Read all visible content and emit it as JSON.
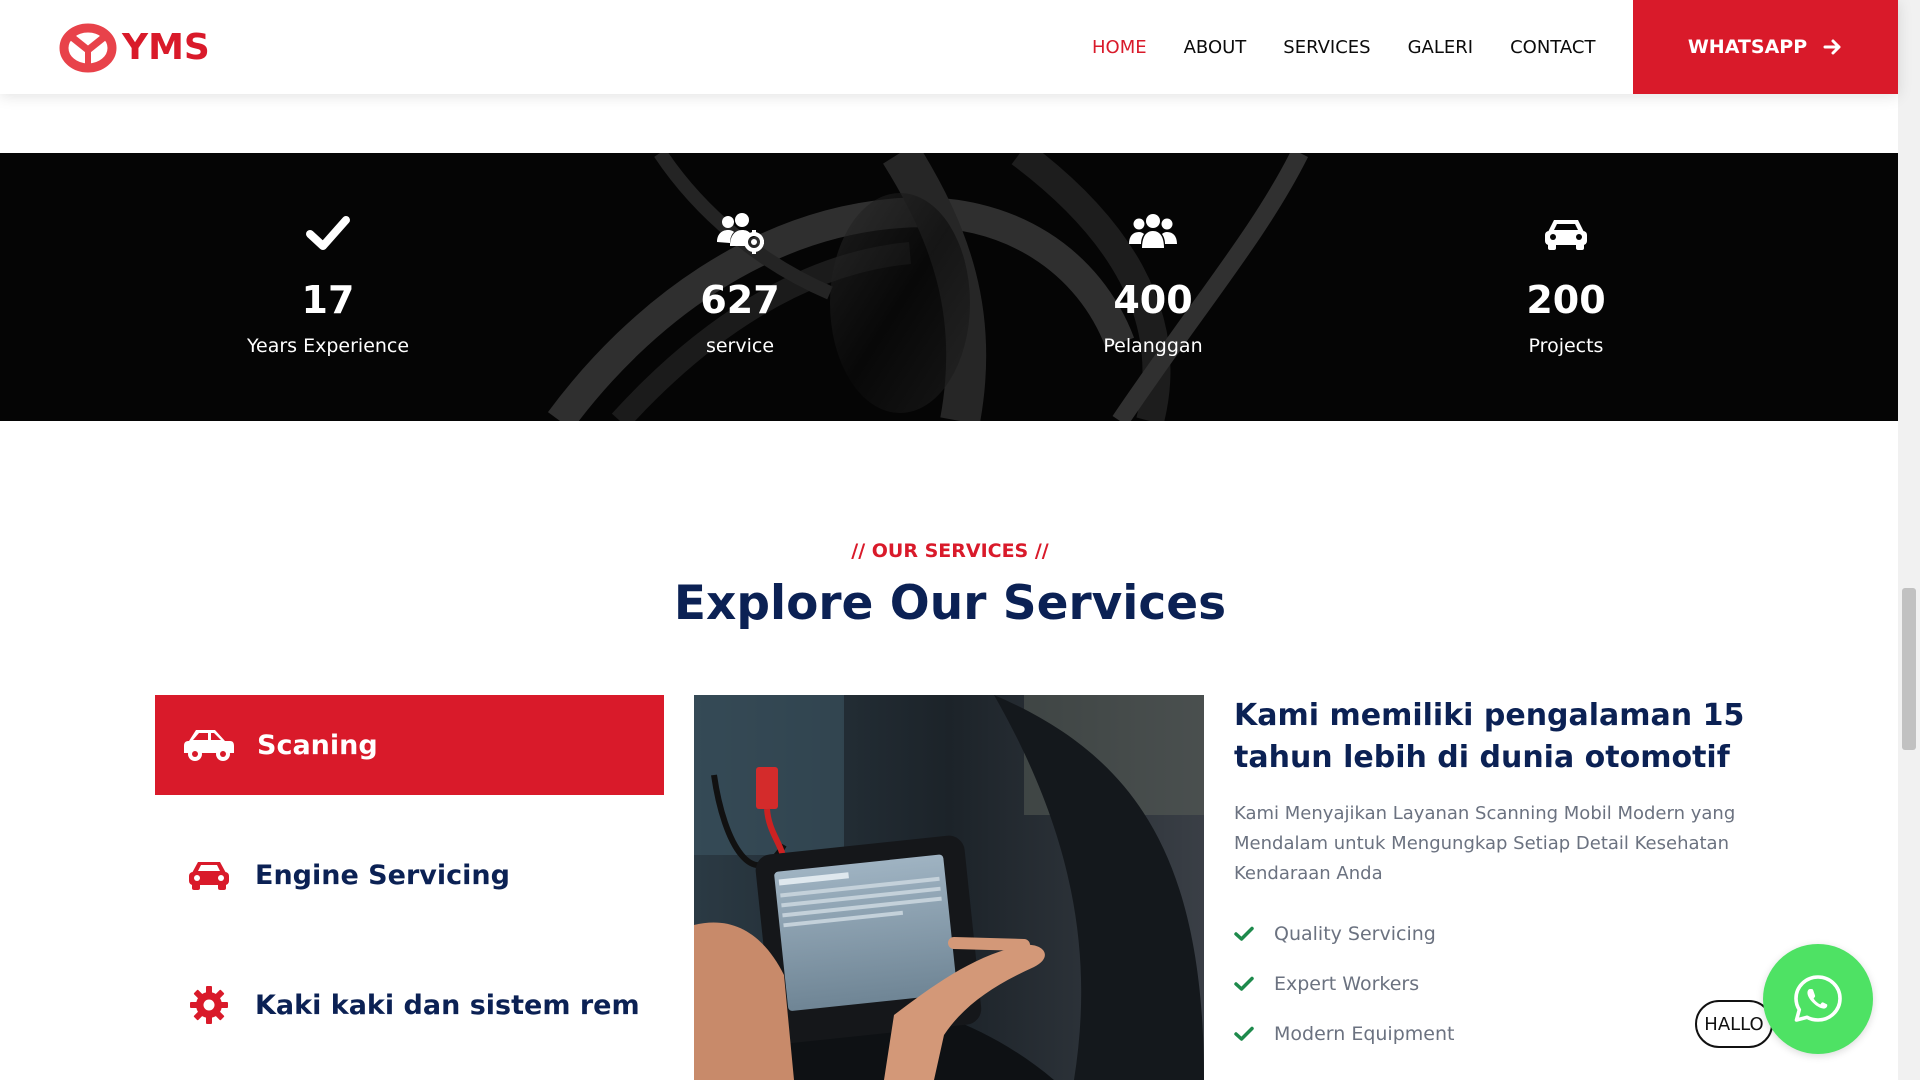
{
  "brand": {
    "logo_text": "YMS",
    "accent_color": "#d91a2a",
    "navy_color": "#0b2154"
  },
  "nav": {
    "items": [
      {
        "label": "HOME",
        "active": true
      },
      {
        "label": "ABOUT",
        "active": false
      },
      {
        "label": "SERVICES",
        "active": false
      },
      {
        "label": "GALERI",
        "active": false
      },
      {
        "label": "CONTACT",
        "active": false
      }
    ],
    "cta_label": "WHATSAPP",
    "cta_icon": "arrow-right-icon"
  },
  "stats": [
    {
      "icon": "check-icon",
      "value": "17",
      "label": "Years Experience"
    },
    {
      "icon": "users-cog-icon",
      "value": "627",
      "label": "service"
    },
    {
      "icon": "users-icon",
      "value": "400",
      "label": "Pelanggan"
    },
    {
      "icon": "car-icon",
      "value": "200",
      "label": "Projects"
    }
  ],
  "services": {
    "eyebrow": "// OUR SERVICES //",
    "title": "Explore Our Services",
    "tabs": [
      {
        "label": "Scaning",
        "icon": "car-icon",
        "active": true
      },
      {
        "label": "Engine Servicing",
        "icon": "car-front-icon",
        "active": false
      },
      {
        "label": "Kaki kaki dan sistem rem",
        "icon": "gear-icon",
        "active": false
      }
    ],
    "detail": {
      "heading": "Kami memiliki pengalaman 15 tahun lebih di dunia otomotif",
      "description": "Kami Menyajikan Layanan Scanning Mobil Modern yang Mendalam untuk Mengungkap Setiap Detail Kesehatan Kendaraan Anda",
      "features": [
        "Quality Servicing",
        "Expert Workers",
        "Modern Equipment"
      ],
      "check_color": "#1e8a4c"
    }
  },
  "whatsapp_float": {
    "bubble_text": "HALLO",
    "icon": "whatsapp-icon",
    "color": "#4ee264"
  }
}
